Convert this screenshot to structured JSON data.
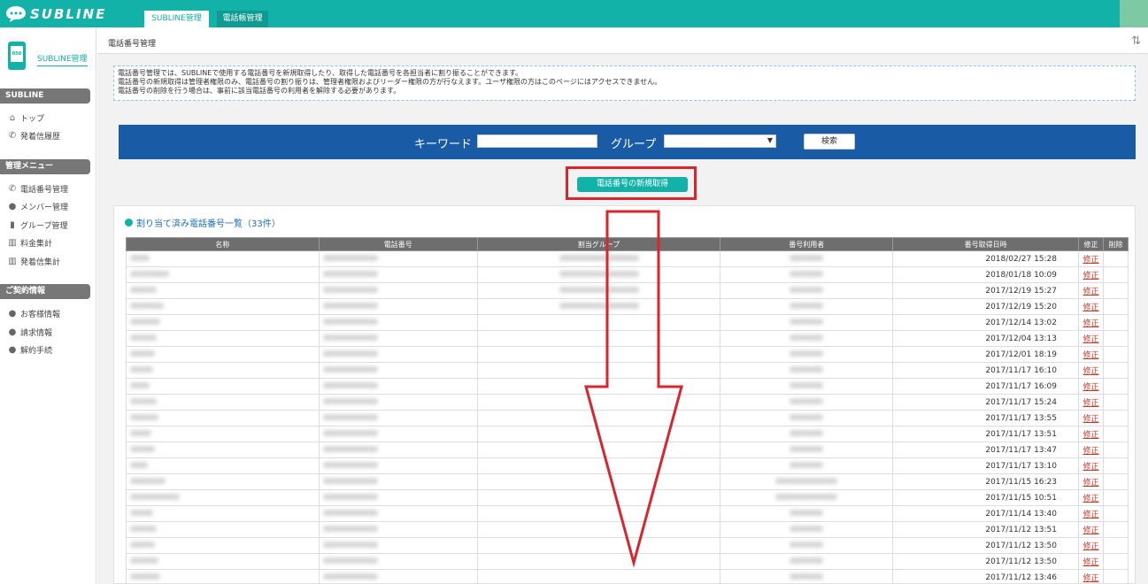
{
  "app": {
    "logo_text": "SUBLINE",
    "tabs": [
      {
        "label": "SUBLINE管理",
        "active": true
      },
      {
        "label": "電話帳管理",
        "active": false
      }
    ]
  },
  "sidebar": {
    "phone_icon_text": "050",
    "title": "SUBLINE管理",
    "sections": [
      {
        "label": "SUBLINE",
        "items": [
          {
            "label": "トップ",
            "icon": "home-icon"
          },
          {
            "label": "発着信履歴",
            "icon": "phone-history-icon"
          }
        ]
      },
      {
        "label": "管理メニュー",
        "items": [
          {
            "label": "電話番号管理",
            "icon": "phone-icon"
          },
          {
            "label": "メンバー管理",
            "icon": "user-icon"
          },
          {
            "label": "グループ管理",
            "icon": "building-icon"
          },
          {
            "label": "料金集計",
            "icon": "chart-icon"
          },
          {
            "label": "発着信集計",
            "icon": "chart-icon"
          }
        ]
      },
      {
        "label": "ご契約情報",
        "items": [
          {
            "label": "お客様情報",
            "icon": "pin-icon"
          },
          {
            "label": "請求情報",
            "icon": "pin-icon"
          },
          {
            "label": "解約手続",
            "icon": "pin-icon"
          }
        ]
      }
    ]
  },
  "main": {
    "header_title": "電話番号管理",
    "notice_lines": [
      "電話番号管理では、SUBLINEで使用する電話番号を新規取得したり、取得した電話番号を各担当者に割り振ることができます。",
      "電話番号の新規取得は管理者権限のみ、電話番号の割り振りは、管理者権限およびリーダー権限の方が行なえます。ユーザ権限の方はこのページにはアクセスできません。",
      "電話番号の削除を行う場合は、事前に該当電話番号の利用者を解除する必要があります。"
    ],
    "search": {
      "keyword_label": "キーワード",
      "group_label": "グループ",
      "keyword_value": "",
      "group_value": "",
      "button_label": "検索"
    },
    "new_button_label": "電話番号の新規取得",
    "list_title": "割り当て済み電話番号一覧（33件）",
    "table": {
      "headers": [
        "名称",
        "電話番号",
        "割当グループ",
        "番号利用者",
        "番号取得日時",
        "修正",
        "削除"
      ],
      "edit_label": "修正",
      "rows": [
        {
          "date": "2018/02/27 15:28",
          "has_group": true
        },
        {
          "date": "2018/01/18 10:09",
          "has_group": true
        },
        {
          "date": "2017/12/19 15:27",
          "has_group": true
        },
        {
          "date": "2017/12/19 15:20",
          "has_group": true
        },
        {
          "date": "2017/12/14 13:02",
          "has_group": false
        },
        {
          "date": "2017/12/04 13:13",
          "has_group": false
        },
        {
          "date": "2017/12/01 18:19",
          "has_group": false
        },
        {
          "date": "2017/11/17 16:10",
          "has_group": false
        },
        {
          "date": "2017/11/17 16:09",
          "has_group": false
        },
        {
          "date": "2017/11/17 15:24",
          "has_group": false
        },
        {
          "date": "2017/11/17 13:55",
          "has_group": false
        },
        {
          "date": "2017/11/17 13:51",
          "has_group": false
        },
        {
          "date": "2017/11/17 13:47",
          "has_group": false
        },
        {
          "date": "2017/11/17 13:10",
          "has_group": false
        },
        {
          "date": "2017/11/15 16:23",
          "has_group": false
        },
        {
          "date": "2017/11/15 10:51",
          "has_group": false
        },
        {
          "date": "2017/11/14 13:40",
          "has_group": false
        },
        {
          "date": "2017/11/12 13:51",
          "has_group": false
        },
        {
          "date": "2017/11/12 13:50",
          "has_group": false
        },
        {
          "date": "2017/11/12 13:50",
          "has_group": false
        },
        {
          "date": "2017/11/12 13:46",
          "has_group": false
        }
      ]
    }
  },
  "colors": {
    "brand": "#12b2a8",
    "search_bar": "#1a5ba6",
    "highlight": "#d9262c"
  }
}
